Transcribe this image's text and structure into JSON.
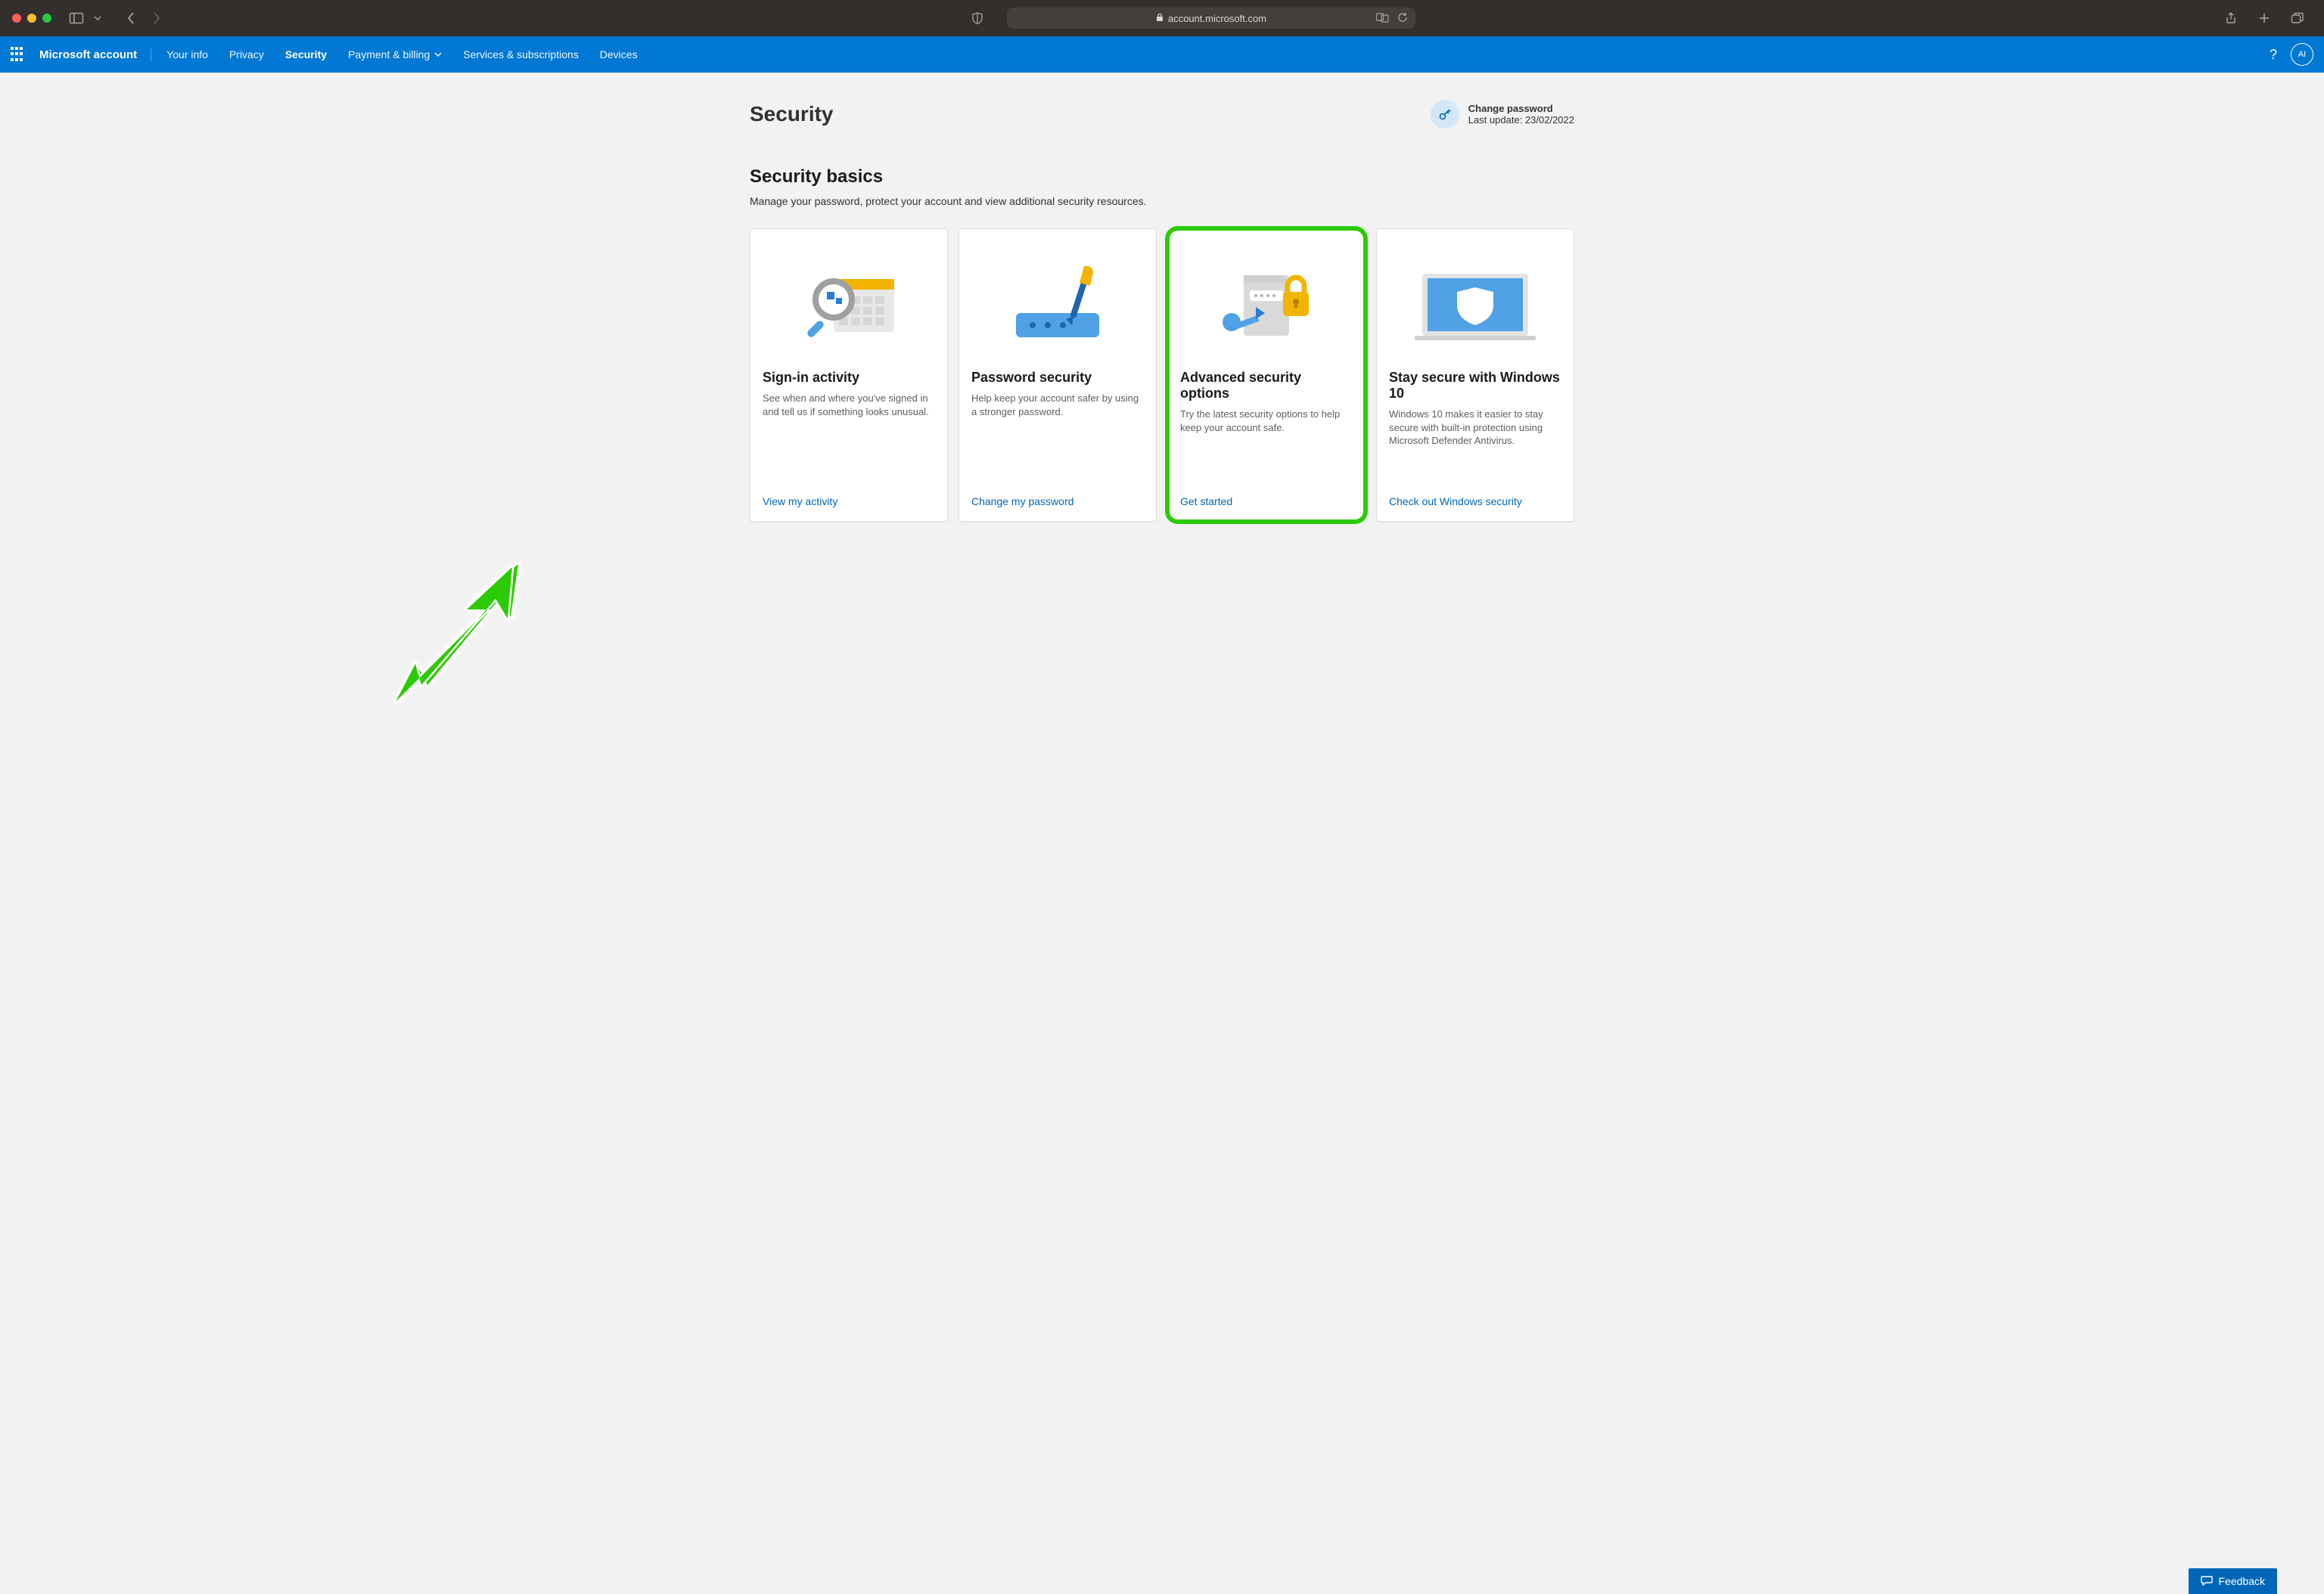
{
  "browser": {
    "url_display": "account.microsoft.com"
  },
  "header": {
    "brand": "Microsoft account",
    "nav": [
      {
        "label": "Your info"
      },
      {
        "label": "Privacy"
      },
      {
        "label": "Security",
        "active": true
      },
      {
        "label": "Payment & billing",
        "dropdown": true
      },
      {
        "label": "Services & subscriptions"
      },
      {
        "label": "Devices"
      }
    ],
    "avatar_initials": "AI"
  },
  "page": {
    "title": "Security",
    "change_password": {
      "title": "Change password",
      "subtitle": "Last update: 23/02/2022"
    },
    "section_title": "Security basics",
    "section_subtitle": "Manage your password, protect your account and view additional security resources.",
    "cards": [
      {
        "title": "Sign-in activity",
        "desc": "See when and where you've signed in and tell us if something looks unusual.",
        "cta": "View my activity"
      },
      {
        "title": "Password security",
        "desc": "Help keep your account safer by using a stronger password.",
        "cta": "Change my password"
      },
      {
        "title": "Advanced security options",
        "desc": "Try the latest security options to help keep your account safe.",
        "cta": "Get started"
      },
      {
        "title": "Stay secure with Windows 10",
        "desc": "Windows 10 makes it easier to stay secure with built-in protection using Microsoft Defender Antivirus.",
        "cta": "Check out Windows security"
      }
    ]
  },
  "feedback_label": "Feedback"
}
